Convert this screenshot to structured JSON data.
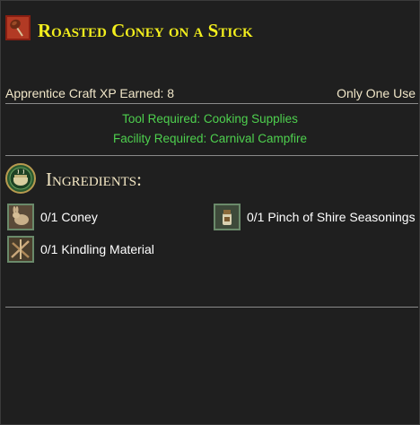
{
  "recipe": {
    "title": "Roasted Coney on a Stick",
    "icon": "roasted-coney-icon",
    "xp_label": "Apprentice Craft XP Earned: 8",
    "use_label": "Only One Use",
    "tool_required": "Tool Required: Cooking Supplies",
    "facility_required": "Facility Required: Carnival Campfire"
  },
  "ingredients": {
    "heading": "Ingredients:",
    "icon": "ingredients-pot-icon",
    "items": [
      {
        "label": "0/1 Coney",
        "icon": "coney-icon"
      },
      {
        "label": "0/1 Pinch of Shire Seasonings",
        "icon": "seasonings-icon"
      },
      {
        "label": "0/1 Kindling Material",
        "icon": "kindling-icon"
      }
    ]
  },
  "colors": {
    "title": "#f3ef1d",
    "requirement": "#4ed04e",
    "text": "#f0e6c8",
    "background": "#1f1f1f"
  }
}
